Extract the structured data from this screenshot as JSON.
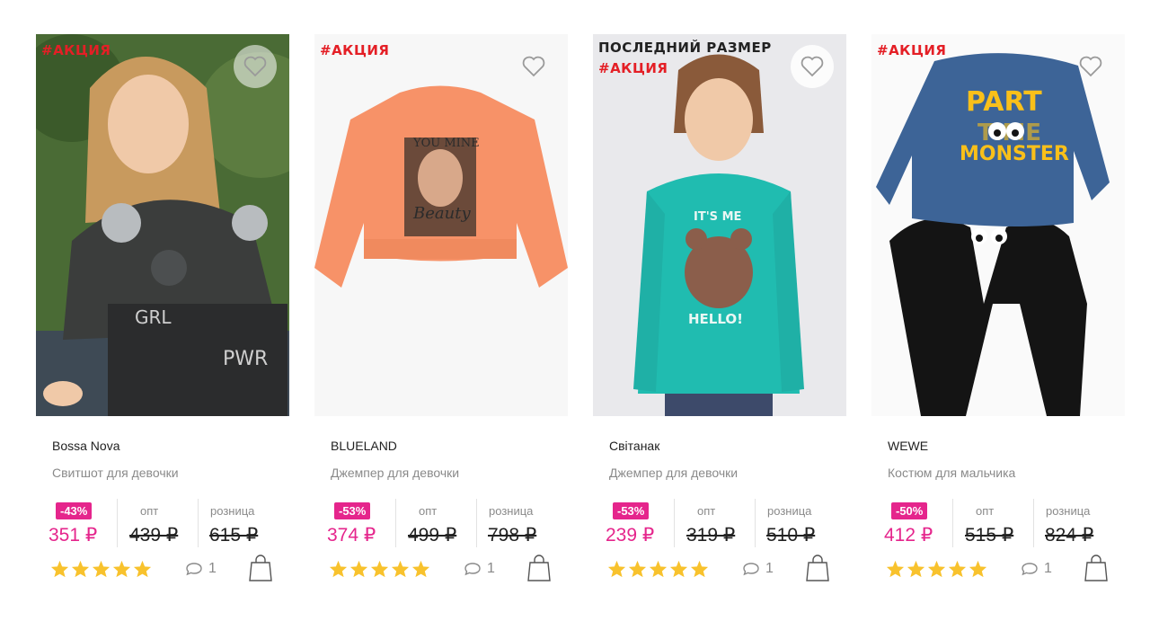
{
  "products": [
    {
      "tags": [
        "#АКЦИЯ"
      ],
      "brand": "Bossa Nova",
      "name": "Свитшот для девочки",
      "discount": "-43%",
      "price_now": "351 ₽",
      "opt_label": "опт",
      "opt_price": "439 ₽",
      "retail_label": "розница",
      "retail_price": "615 ₽",
      "rating": 5,
      "comments": "1"
    },
    {
      "tags": [
        "#АКЦИЯ"
      ],
      "brand": "BLUELAND",
      "name": "Джемпер для девочки",
      "discount": "-53%",
      "price_now": "374 ₽",
      "opt_label": "опт",
      "opt_price": "499 ₽",
      "retail_label": "розница",
      "retail_price": "798 ₽",
      "rating": 5,
      "comments": "1"
    },
    {
      "tags": [
        "ПОСЛЕДНИЙ РАЗМЕР",
        "#АКЦИЯ"
      ],
      "brand": "Світанак",
      "name": "Джемпер для девочки",
      "discount": "-53%",
      "price_now": "239 ₽",
      "opt_label": "опт",
      "opt_price": "319 ₽",
      "retail_label": "розница",
      "retail_price": "510 ₽",
      "rating": 5,
      "comments": "1"
    },
    {
      "tags": [
        "#АКЦИЯ"
      ],
      "brand": "WEWE",
      "name": "Костюм для мальчика",
      "discount": "-50%",
      "price_now": "412 ₽",
      "opt_label": "опт",
      "opt_price": "515 ₽",
      "retail_label": "розница",
      "retail_price": "824 ₽",
      "rating": 5,
      "comments": "1"
    }
  ],
  "image_text": {
    "p2": "Beauty",
    "p2_top": "YOU MINE",
    "p3_top": "IT'S ME",
    "p3_bottom": "HELLO!",
    "p4_line1": "PART",
    "p4_line2": "TIME",
    "p4_line3": "MONSTER",
    "p1_grl": "GRL",
    "p1_pwr": "PWR"
  },
  "colors": {
    "accent": "#e5258c",
    "promo_red": "#e41f26",
    "star": "#f8c22d"
  },
  "icons": {
    "favorite": "heart-outline-icon",
    "rating": "star-icon",
    "comments": "comment-bubble-icon",
    "cart": "shopping-bag-icon"
  }
}
